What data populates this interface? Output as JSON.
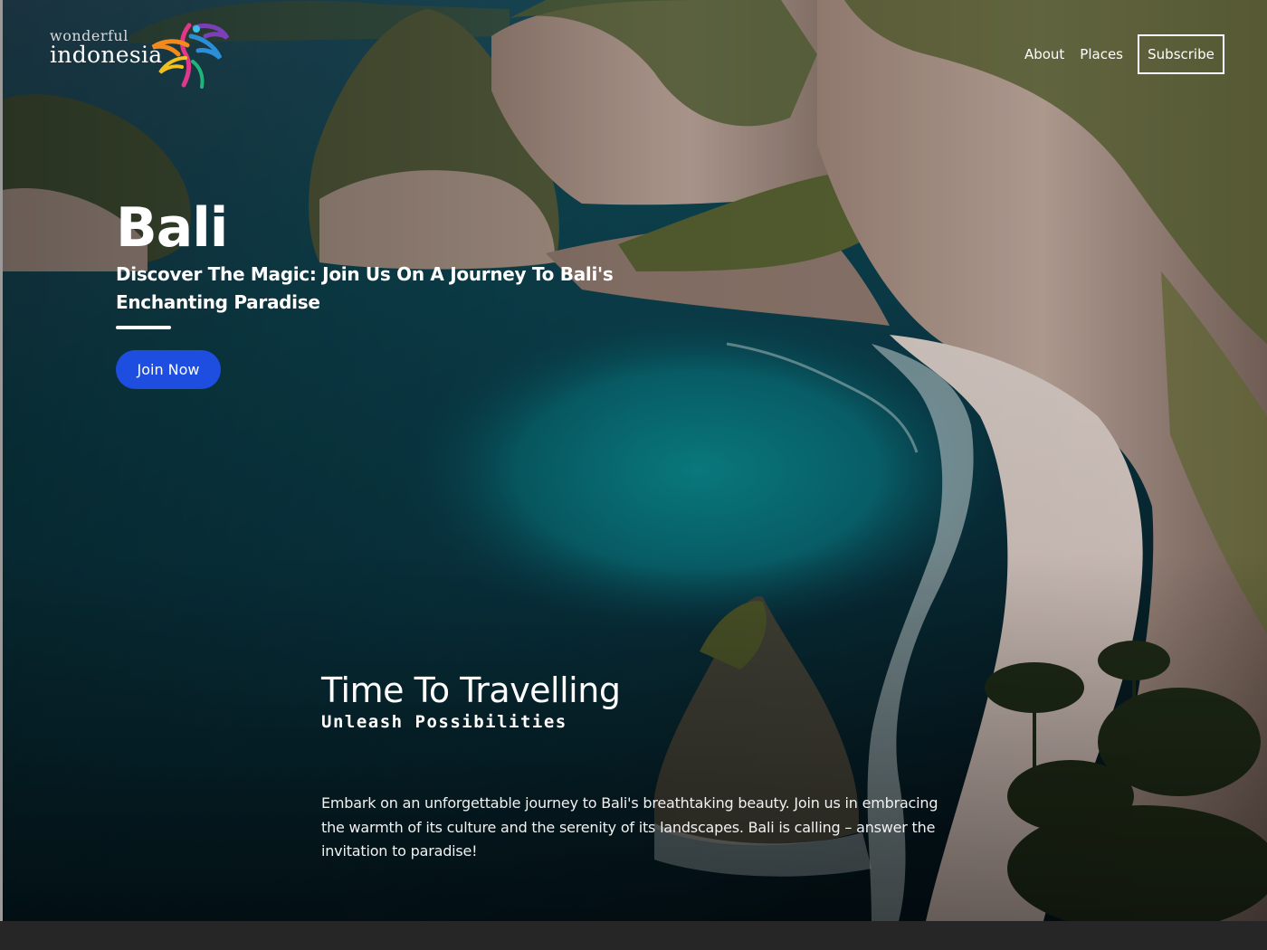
{
  "brand": {
    "logo_small": "wonderful",
    "logo_big": "indonesia"
  },
  "nav": {
    "items": [
      {
        "label": "About"
      },
      {
        "label": "Places"
      }
    ],
    "subscribe_label": "Subscribe"
  },
  "hero": {
    "title": "Bali",
    "subtitle": "Discover The Magic: Join Us On A Journey To Bali's Enchanting Paradise",
    "cta_label": "Join Now"
  },
  "section": {
    "title": "Time To Travelling",
    "subtitle": "Unleash Possibilities",
    "body": "Embark on an unforgettable journey to Bali's breathtaking beauty. Join us in embracing the warmth of its culture and the serenity of its landscapes. Bali is calling – answer the invitation to paradise!"
  },
  "colors": {
    "accent": "#1d4ee0",
    "text": "#ffffff",
    "footer": "#262626"
  }
}
